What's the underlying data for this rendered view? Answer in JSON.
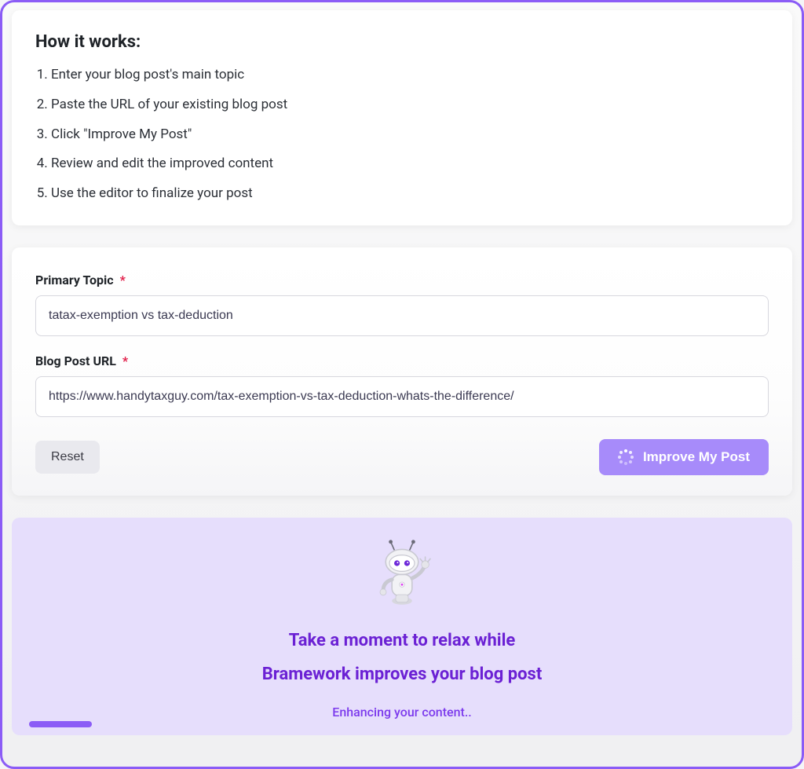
{
  "how": {
    "title": "How it works:",
    "steps": [
      "Enter your blog post's main topic",
      "Paste the URL of your existing blog post",
      "Click \"Improve My Post\"",
      "Review and edit the improved content",
      "Use the editor to finalize your post"
    ]
  },
  "form": {
    "topic_label": "Primary Topic",
    "topic_value": "tatax-exemption vs tax-deduction",
    "url_label": "Blog Post URL",
    "url_value": "https://www.handytaxguy.com/tax-exemption-vs-tax-deduction-whats-the-difference/",
    "required_mark": "*",
    "reset_label": "Reset",
    "improve_label": "Improve My Post"
  },
  "loading": {
    "line1": "Take a moment to relax while",
    "line2": "Bramework improves your blog post",
    "status": "Enhancing your content.."
  },
  "colors": {
    "accent": "#8b5cf6",
    "accent_light": "#a78bfa",
    "panel_bg": "#e6defc",
    "heading_purple": "#6b21d4"
  }
}
